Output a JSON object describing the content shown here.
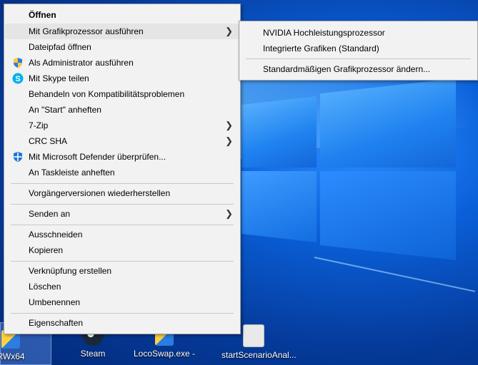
{
  "main_menu": {
    "items": [
      {
        "label": "Öffnen",
        "bold": true
      },
      {
        "label": "Mit Grafikprozessor ausführen",
        "submenu": true,
        "highlighted": true
      },
      {
        "label": "Dateipfad öffnen"
      },
      {
        "label": "Als Administrator ausführen",
        "icon": "uac-shield-icon"
      },
      {
        "label": "Mit Skype teilen",
        "icon": "skype-icon"
      },
      {
        "label": "Behandeln von Kompatibilitätsproblemen"
      },
      {
        "label": "An \"Start\" anheften"
      },
      {
        "label": "7-Zip",
        "submenu": true
      },
      {
        "label": "CRC SHA",
        "submenu": true
      },
      {
        "label": "Mit Microsoft Defender überprüfen...",
        "icon": "defender-icon"
      },
      {
        "label": "An Taskleiste anheften"
      },
      {
        "label": "Vorgängerversionen wiederherstellen"
      },
      {
        "label": "Senden an",
        "submenu": true
      },
      {
        "label": "Ausschneiden"
      },
      {
        "label": "Kopieren"
      },
      {
        "label": "Verknüpfung erstellen"
      },
      {
        "label": "Löschen"
      },
      {
        "label": "Umbenennen"
      },
      {
        "label": "Eigenschaften"
      }
    ]
  },
  "gpu_submenu": {
    "items": [
      {
        "label": "NVIDIA Hochleistungsprozessor"
      },
      {
        "label": "Integrierte Grafiken (Standard)"
      },
      {
        "label": "Standardmäßigen Grafikprozessor ändern..."
      }
    ]
  },
  "desktop_icons": [
    {
      "label": "RWx64"
    },
    {
      "label": "Steam"
    },
    {
      "label": "LocoSwap.exe -"
    },
    {
      "label": "startScenarioAnal..."
    }
  ],
  "colors": {
    "menu_bg": "#f2f2f2",
    "highlight": "#e5e5e5",
    "desktop_blue": "#0a5fd8"
  }
}
